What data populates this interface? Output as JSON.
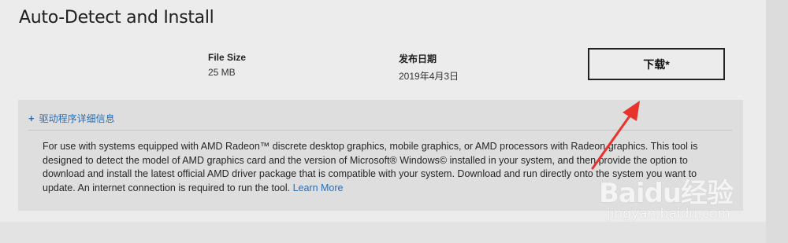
{
  "section": {
    "title": "Auto-Detect and Install"
  },
  "file_info": {
    "size_label": "File Size",
    "size_value": "25 MB",
    "date_label": "发布日期",
    "date_value": "2019年4月3日"
  },
  "download": {
    "label": "下载*"
  },
  "details": {
    "toggle_label": "驱动程序详细信息",
    "description": "For use with systems equipped with AMD Radeon™ discrete desktop graphics, mobile graphics, or AMD processors with Radeon graphics. This tool is designed to detect the model of AMD graphics card and the version of Microsoft® Windows© installed in your system, and then provide the option to download and install the latest official AMD driver package that is compatible with your system. Download and run directly onto the system you want to update. An internet connection is required to run the tool.",
    "learn_more": "Learn More"
  },
  "watermark": {
    "logo": "Baidu经验",
    "url": "jingyan.baidu.com"
  },
  "colors": {
    "link": "#2a6db5",
    "annotation_arrow": "#e8332d"
  }
}
